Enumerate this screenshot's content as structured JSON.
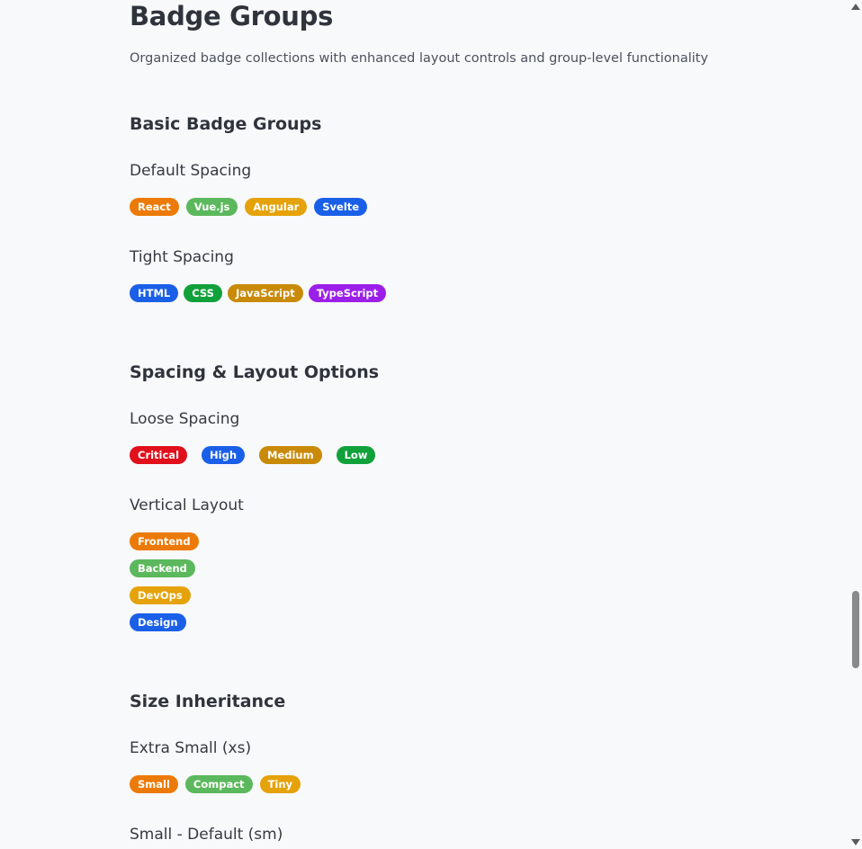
{
  "page": {
    "title": "Badge Groups",
    "subtitle": "Organized badge collections with enhanced layout controls and group-level functionality"
  },
  "sections": [
    {
      "title": "Basic Badge Groups",
      "groups": [
        {
          "title": "Default Spacing",
          "badges": [
            "React",
            "Vue.js",
            "Angular",
            "Svelte"
          ]
        },
        {
          "title": "Tight Spacing",
          "badges": [
            "HTML",
            "CSS",
            "JavaScript",
            "TypeScript"
          ]
        }
      ]
    },
    {
      "title": "Spacing & Layout Options",
      "groups": [
        {
          "title": "Loose Spacing",
          "badges": [
            "Critical",
            "High",
            "Medium",
            "Low"
          ]
        },
        {
          "title": "Vertical Layout",
          "badges": [
            "Frontend",
            "Backend",
            "DevOps",
            "Design"
          ]
        }
      ]
    },
    {
      "title": "Size Inheritance",
      "groups": [
        {
          "title": "Extra Small (xs)",
          "badges": [
            "Small",
            "Compact",
            "Tiny"
          ]
        },
        {
          "title": "Small - Default (sm)",
          "badges": []
        }
      ]
    }
  ],
  "colors": {
    "orange": "#ec7a08",
    "green": "#5cb85c",
    "amber": "#e5a20a",
    "blue": "#1a5fe8",
    "dark_green": "#11a13b",
    "gold": "#c98a08",
    "purple": "#9b1fe8",
    "red": "#e0101c"
  },
  "scrollbar": {
    "icons": [
      "scroll-up-arrow-icon",
      "scroll-down-arrow-icon"
    ]
  }
}
